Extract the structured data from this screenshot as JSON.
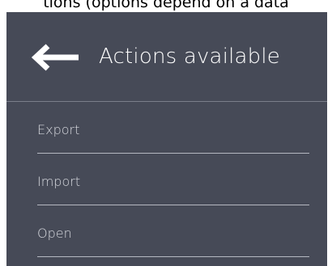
{
  "caption": "tions (options depend on a data",
  "header": {
    "back_icon": "arrow-left-icon",
    "title": "Actions available"
  },
  "menu": {
    "items": [
      {
        "label": "Export"
      },
      {
        "label": "Import"
      },
      {
        "label": "Open"
      }
    ]
  },
  "colors": {
    "panel_background": "#464a57",
    "title_text": "#ffffff",
    "item_text": "#d6d8de",
    "divider": "#b5b8c1"
  }
}
